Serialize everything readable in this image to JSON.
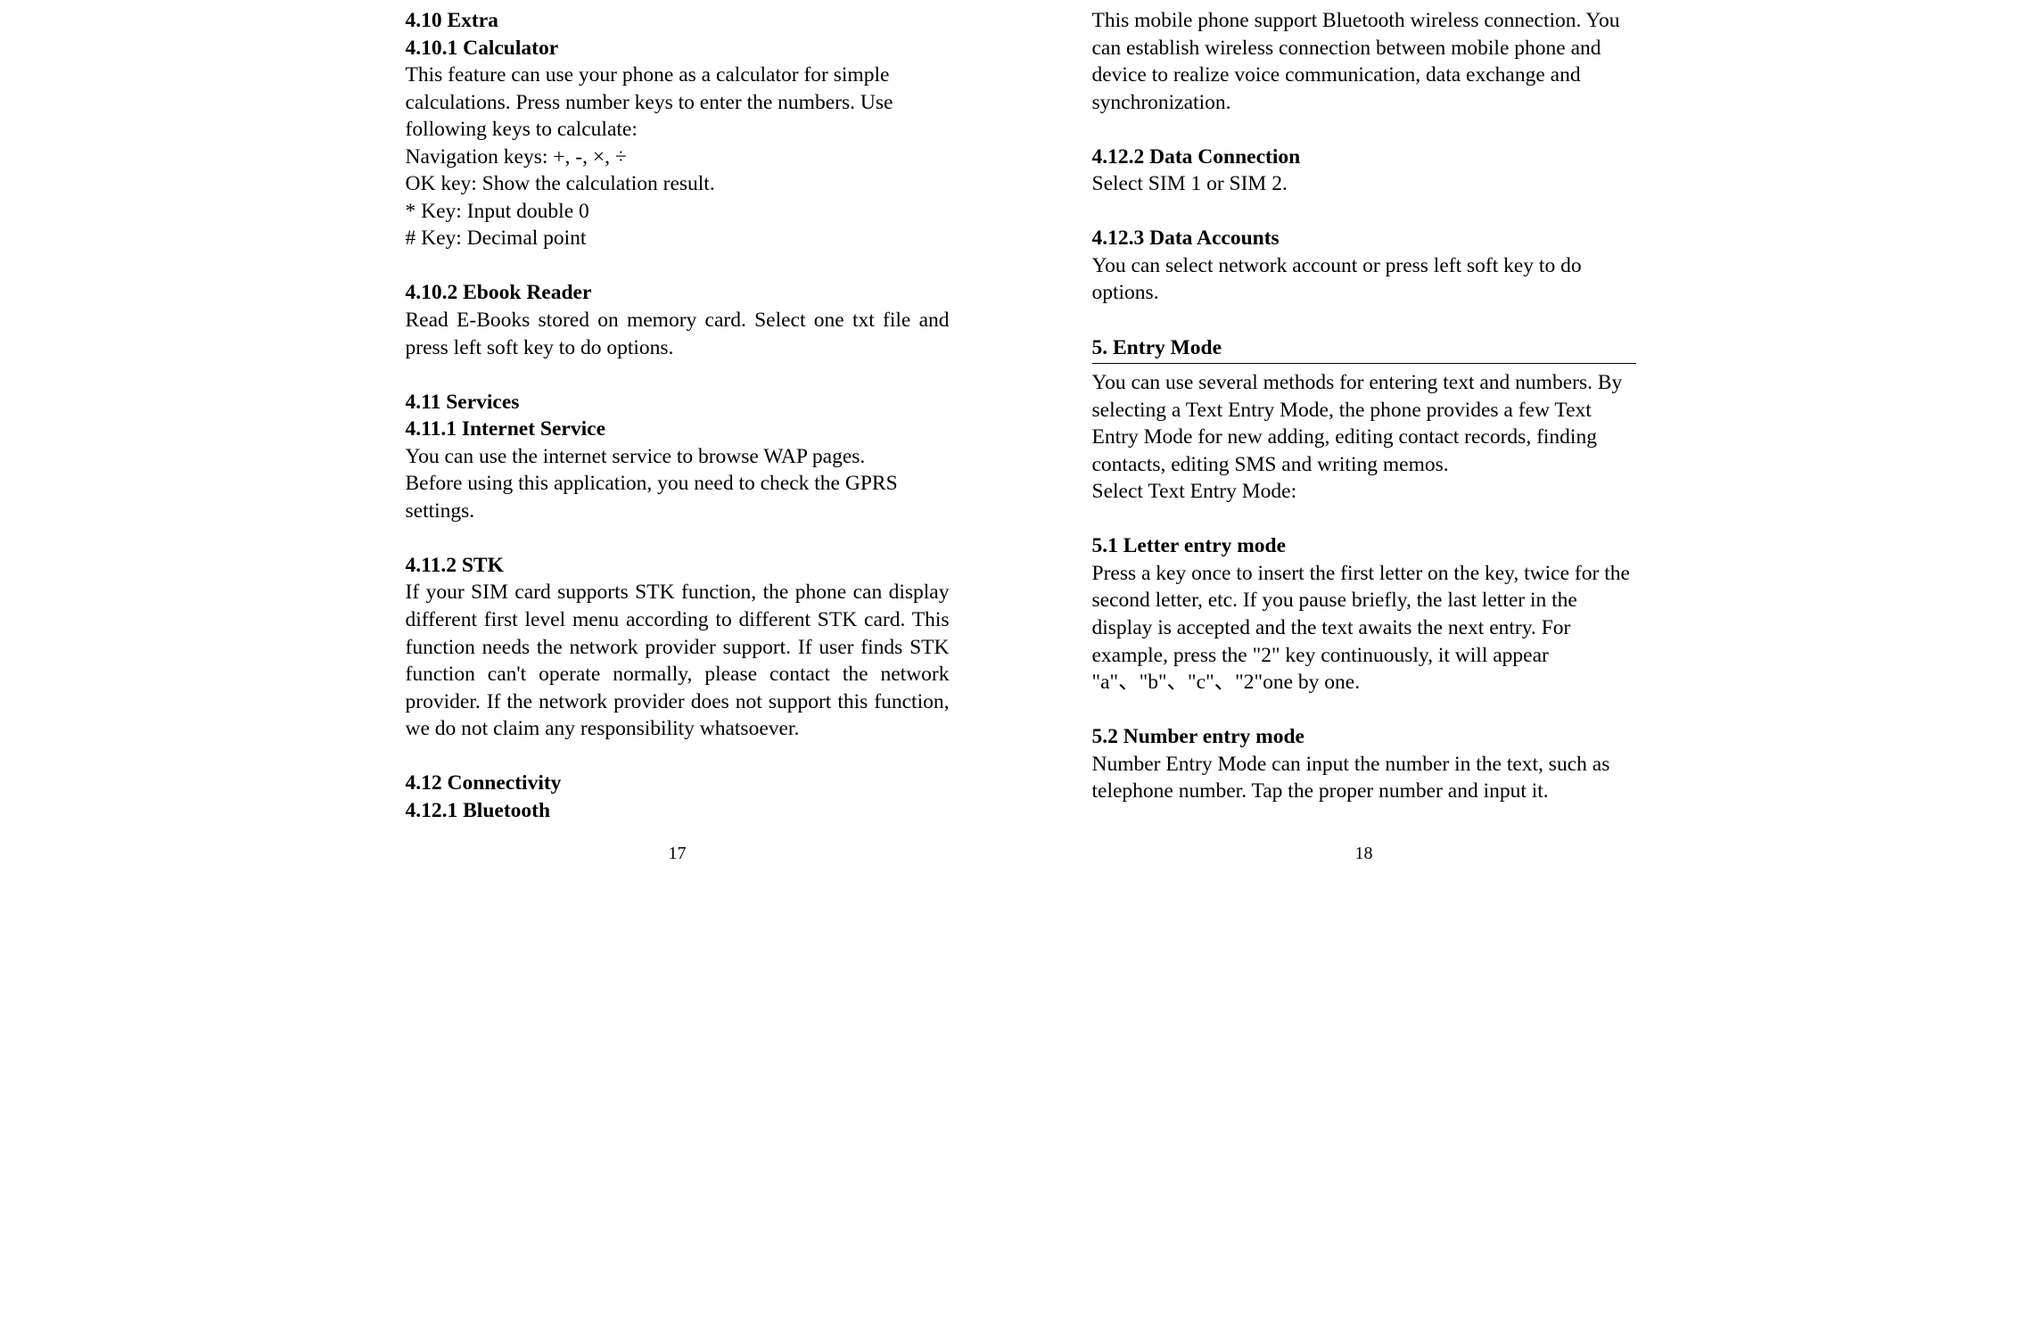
{
  "left": {
    "h_4_10": "4.10 Extra",
    "h_4_10_1": "4.10.1 Calculator",
    "p_calc_1": "This feature can use your phone as a calculator for simple calculations. Press number keys to enter the numbers. Use following keys to calculate:",
    "p_calc_nav": "Navigation keys: +, -, ×, ÷",
    "p_calc_ok": "OK key: Show the calculation result.",
    "p_calc_star": "* Key: Input double 0",
    "p_calc_hash": "# Key: Decimal point",
    "h_4_10_2": "4.10.2 Ebook Reader",
    "p_ebook": "Read E-Books stored on memory card. Select one txt file and press left soft key to do options.",
    "h_4_11": "4.11 Services",
    "h_4_11_1": "4.11.1 Internet Service",
    "p_internet_1": "You can use the internet service to browse WAP pages.",
    "p_internet_2": "Before using this application, you need to check the GPRS settings.",
    "h_4_11_2": "4.11.2 STK",
    "p_stk": "If your SIM card supports STK function, the phone can display different first level menu according to different STK card. This function needs the network provider support. If user finds STK function can't operate normally, please contact the network provider. If the network provider does not support this function, we do not claim any responsibility whatsoever.",
    "h_4_12": "4.12 Connectivity",
    "h_4_12_1": "4.12.1 Bluetooth",
    "page_num": "17"
  },
  "right": {
    "p_bt": "This mobile phone support Bluetooth wireless connection. You can establish wireless connection between mobile phone and device to realize voice communication, data exchange and synchronization.",
    "h_4_12_2": "4.12.2 Data Connection",
    "p_dataconn": "Select SIM 1 or SIM 2.",
    "h_4_12_3": "4.12.3 Data Accounts",
    "p_dataacc": "You can select network account or press left soft key to do options.",
    "h_5": "5. Entry Mode",
    "p_entry_1": "You can use several methods for entering text and numbers. By selecting a Text Entry Mode, the phone provides a few Text Entry Mode for new adding, editing contact records, finding contacts, editing SMS and writing memos.",
    "p_entry_2": "Select Text Entry Mode:",
    "h_5_1": "5.1 Letter entry mode",
    "p_letter": "Press a key once to insert the first letter on the key, twice for the second letter, etc. If you pause briefly, the last letter in the display is accepted and the text awaits the next entry. For example, press the \"2\" key continuously, it will appear \"a\"、\"b\"、\"c\"、\"2\"one by one.",
    "h_5_2": "5.2 Number entry mode",
    "p_number": "Number Entry Mode can input the number in the text, such as telephone number. Tap the proper number and input it.",
    "page_num": "18"
  }
}
